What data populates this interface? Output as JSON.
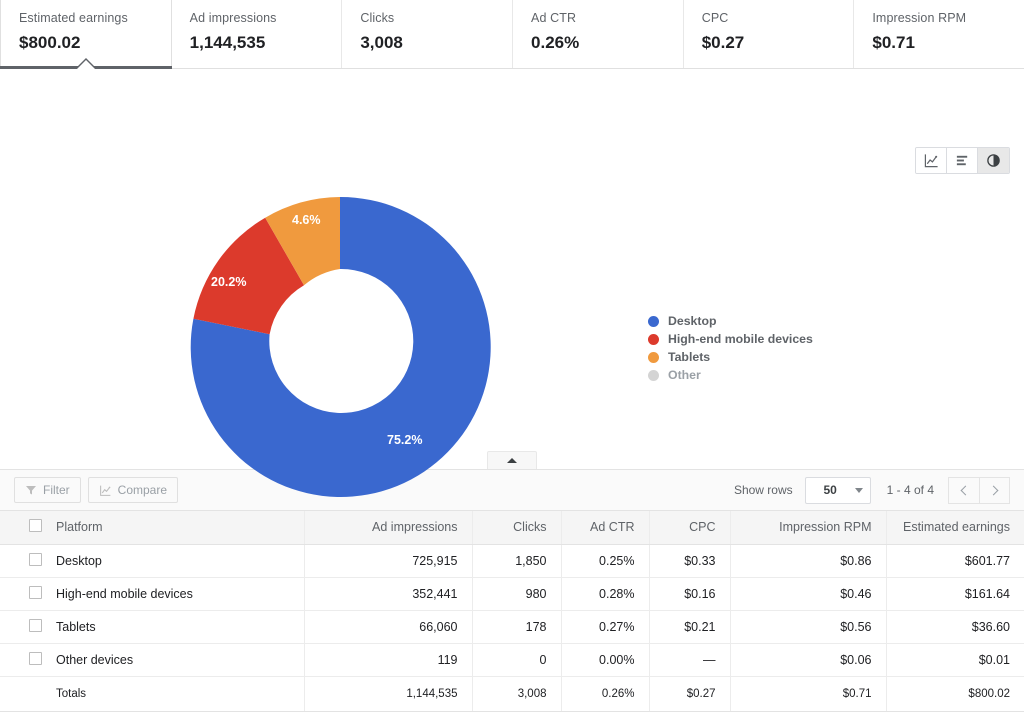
{
  "metrics": [
    {
      "label": "Estimated earnings",
      "value": "$800.02",
      "active": true
    },
    {
      "label": "Ad impressions",
      "value": "1,144,535",
      "active": false
    },
    {
      "label": "Clicks",
      "value": "3,008",
      "active": false
    },
    {
      "label": "Ad CTR",
      "value": "0.26%",
      "active": false
    },
    {
      "label": "CPC",
      "value": "$0.27",
      "active": false
    },
    {
      "label": "Impression RPM",
      "value": "$0.71",
      "active": false
    }
  ],
  "chart_toggles": [
    {
      "icon": "line-chart-icon",
      "selected": false
    },
    {
      "icon": "bar-chart-icon",
      "selected": false
    },
    {
      "icon": "pie-chart-icon",
      "selected": true
    }
  ],
  "chart_data": {
    "type": "pie",
    "variant": "donut",
    "title": "",
    "categories": [
      "Desktop",
      "High-end mobile devices",
      "Tablets",
      "Other"
    ],
    "values": [
      75.2,
      20.2,
      4.6,
      0.0
    ],
    "value_labels": [
      "75.2%",
      "20.2%",
      "4.6%",
      ""
    ],
    "colors": [
      "#3a68cf",
      "#dc3a2c",
      "#f09a3e",
      "#d4d4d4"
    ],
    "legend_position": "right",
    "inner_radius_ratio": 0.46,
    "start_angle_deg": 0,
    "grid": false
  },
  "legend": [
    {
      "label": "Desktop",
      "color": "#3a68cf",
      "muted": false
    },
    {
      "label": "High-end mobile devices",
      "color": "#dc3a2c",
      "muted": false
    },
    {
      "label": "Tablets",
      "color": "#f09a3e",
      "muted": false
    },
    {
      "label": "Other",
      "color": "#d4d4d4",
      "muted": true
    }
  ],
  "toolbar": {
    "filter_label": "Filter",
    "compare_label": "Compare",
    "show_rows_label": "Show rows",
    "rows_value": "50",
    "range_text": "1 - 4 of 4"
  },
  "table": {
    "columns": [
      "Platform",
      "Ad impressions",
      "Clicks",
      "Ad CTR",
      "CPC",
      "Impression RPM",
      "Estimated earnings"
    ],
    "rows": [
      {
        "platform": "Desktop",
        "impressions": "725,915",
        "clicks": "1,850",
        "ctr": "0.25%",
        "cpc": "$0.33",
        "rpm": "$0.86",
        "earnings": "$601.77"
      },
      {
        "platform": "High-end mobile devices",
        "impressions": "352,441",
        "clicks": "980",
        "ctr": "0.28%",
        "cpc": "$0.16",
        "rpm": "$0.46",
        "earnings": "$161.64"
      },
      {
        "platform": "Tablets",
        "impressions": "66,060",
        "clicks": "178",
        "ctr": "0.27%",
        "cpc": "$0.21",
        "rpm": "$0.56",
        "earnings": "$36.60"
      },
      {
        "platform": "Other devices",
        "impressions": "119",
        "clicks": "0",
        "ctr": "0.00%",
        "cpc": "—",
        "rpm": "$0.06",
        "earnings": "$0.01"
      }
    ],
    "totals": {
      "platform": "Totals",
      "impressions": "1,144,535",
      "clicks": "3,008",
      "ctr": "0.26%",
      "cpc": "$0.27",
      "rpm": "$0.71",
      "earnings": "$800.02"
    }
  }
}
